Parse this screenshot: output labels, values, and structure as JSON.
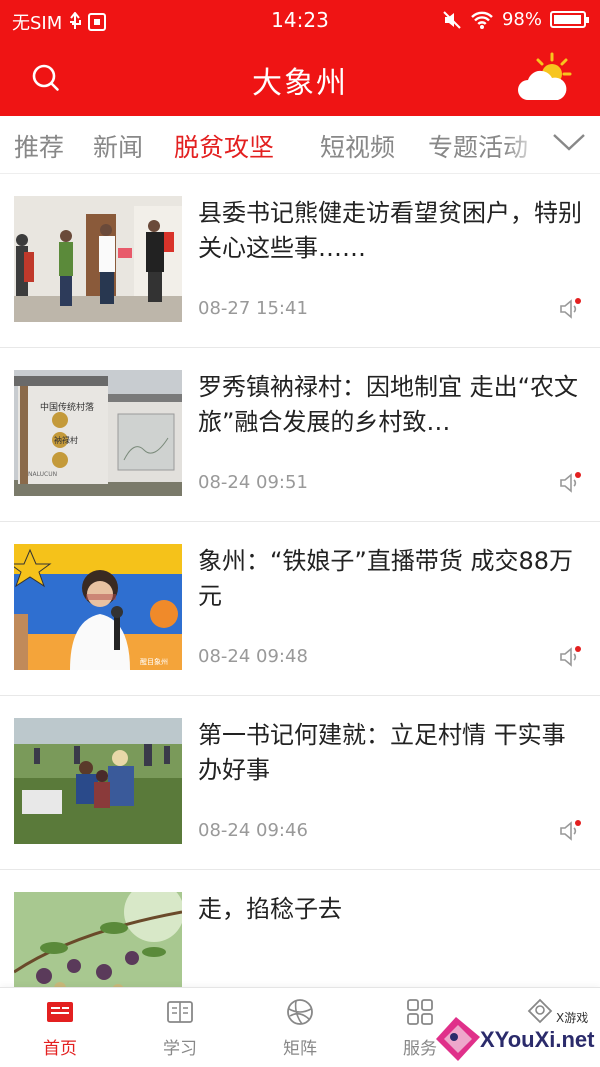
{
  "status_bar": {
    "carrier": "无SIM",
    "time": "14:23",
    "battery_percent": "98%",
    "battery_level": 0.98,
    "icons": [
      "usb-icon",
      "sim-icon",
      "mute-icon",
      "wifi-icon",
      "battery-icon"
    ]
  },
  "header": {
    "title": "大象州",
    "search_icon": "search-icon",
    "weather_icon": "partly-sunny-icon",
    "background_color": "#ef1414"
  },
  "tabs": {
    "items": [
      "推荐",
      "新闻",
      "脱贫攻坚",
      "短视频",
      "专题活动"
    ],
    "active": "脱贫攻坚",
    "active_color": "#e32020",
    "expand_icon": "chevron-down-icon"
  },
  "news": [
    {
      "headline": "县委书记熊健走访看望贫困户，特别关心这些事……",
      "time": "08-27 15:41",
      "icon": "speaker-icon"
    },
    {
      "headline": "罗秀镇衲禄村：因地制宜 走出“农文旅”融合发展的乡村致…",
      "time": "08-24 09:51",
      "icon": "speaker-icon",
      "thumb_text": [
        "中国传统村落",
        "衲禄村",
        "NALUCUN"
      ]
    },
    {
      "headline": "象州：“铁娘子”直播带货 成交88万元",
      "time": "08-24 09:48",
      "icon": "speaker-icon",
      "thumb_text": [
        "醒目象州"
      ]
    },
    {
      "headline": "第一书记何建就：立足村情 干实事 办好事",
      "time": "08-24 09:46",
      "icon": "speaker-icon"
    },
    {
      "headline": "走，掐稔子去",
      "time": "",
      "icon": ""
    }
  ],
  "tabbar": {
    "items": [
      {
        "label": "首页",
        "icon": "home-news-icon"
      },
      {
        "label": "学习",
        "icon": "book-icon"
      },
      {
        "label": "矩阵",
        "icon": "globe-icon"
      },
      {
        "label": "服务",
        "icon": "grid-icon"
      },
      {
        "label": "",
        "icon": "profile-icon"
      }
    ],
    "active": "首页"
  },
  "watermark": {
    "text": "XYouXi.net",
    "small": "X游戏"
  }
}
